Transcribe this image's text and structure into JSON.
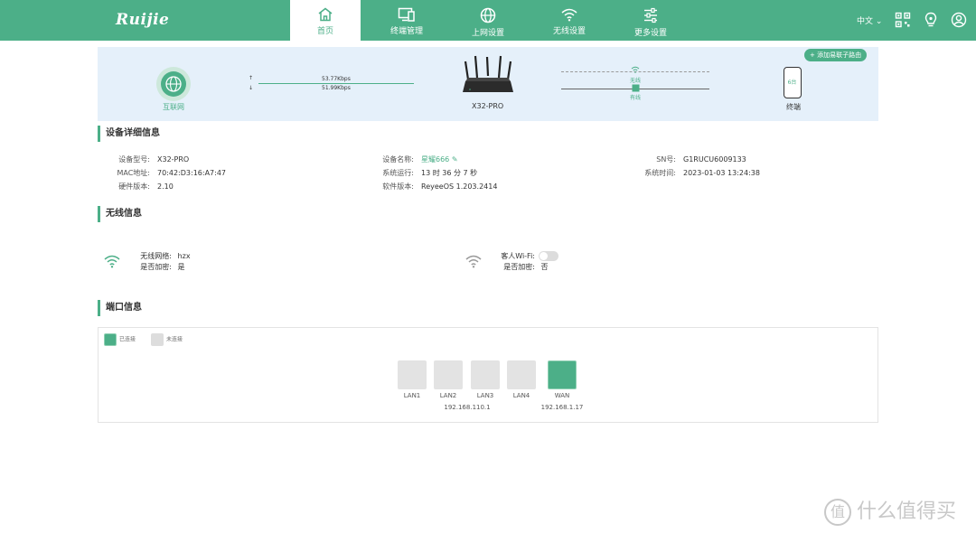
{
  "brand": {
    "logo": "Ruijie",
    "accent": "#4caf88"
  },
  "nav": {
    "tabs": [
      {
        "label": "首页",
        "icon": "home-icon",
        "active": true
      },
      {
        "label": "终端管理",
        "icon": "devices-icon"
      },
      {
        "label": "上网设置",
        "icon": "globe-icon"
      },
      {
        "label": "无线设置",
        "icon": "wifi-icon"
      },
      {
        "label": "更多设置",
        "icon": "sliders-icon"
      }
    ],
    "language": "中文",
    "icons": [
      "qrcode-icon",
      "lightbulb-icon",
      "user-icon"
    ]
  },
  "topology": {
    "add_button": "+ 添加易联子路由",
    "internet_label": "互联网",
    "upload_speed": "53.77Kbps",
    "download_speed": "51.99Kbps",
    "router_name": "X32-PRO",
    "wireless_label": "无线",
    "wired_label": "有线",
    "terminal_count": "6台",
    "terminal_label": "终端"
  },
  "device_info": {
    "title": "设备详细信息",
    "model_label": "设备型号:",
    "model": "X32-PRO",
    "mac_label": "MAC地址:",
    "mac": "70:42:D3:16:A7:47",
    "hw_label": "硬件版本:",
    "hw": "2.10",
    "name_label": "设备名称:",
    "name": "星耀666",
    "uptime_label": "系统运行:",
    "uptime": "13 时 36 分 7 秒",
    "sw_label": "软件版本:",
    "sw": "ReyeeOS 1.203.2414",
    "sn_label": "SN号:",
    "sn": "G1RUCU6009133",
    "time_label": "系统时间:",
    "time": "2023-01-03 13:24:38"
  },
  "wireless_info": {
    "title": "无线信息",
    "ssid_label": "无线网络:",
    "ssid": "hzx",
    "encrypt_label": "是否加密:",
    "encrypt": "是",
    "guest_label": "客人Wi-Fi:",
    "guest_encrypt_label": "是否加密:",
    "guest_encrypt": "否",
    "guest_enabled": false
  },
  "port_info": {
    "title": "端口信息",
    "legend_connected": "已连接",
    "legend_disconnected": "未连接",
    "ports": [
      {
        "label": "LAN1",
        "connected": false
      },
      {
        "label": "LAN2",
        "connected": false
      },
      {
        "label": "LAN3",
        "connected": false
      },
      {
        "label": "LAN4",
        "connected": false
      },
      {
        "label": "WAN",
        "connected": true
      }
    ],
    "lan_ip": "192.168.110.1",
    "wan_ip": "192.168.1.17"
  },
  "watermark": {
    "text": "什么值得买",
    "logo_char": "值"
  }
}
